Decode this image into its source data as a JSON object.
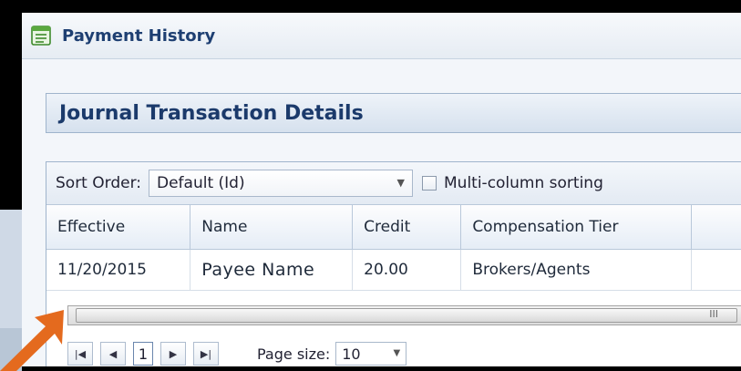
{
  "window": {
    "title": "Payment History"
  },
  "section": {
    "title": "Journal Transaction Details"
  },
  "sort": {
    "label": "Sort Order:",
    "selected": "Default (Id)",
    "multi_column_label": "Multi-column sorting"
  },
  "table": {
    "columns": [
      "Effective",
      "Name",
      "Credit",
      "Compensation Tier"
    ],
    "rows": [
      {
        "effective": "11/20/2015",
        "name": "Payee Name",
        "credit": "20.00",
        "tier": "Brokers/Agents"
      }
    ]
  },
  "scrollbar": {
    "grip": "III"
  },
  "pager": {
    "current_page": "1",
    "page_size_label": "Page size:",
    "page_size_value": "10"
  },
  "colors": {
    "accent": "#1e3f72",
    "annotation_arrow": "#e46a1e"
  },
  "icons": [
    "window-list-icon",
    "dropdown-arrow-icon",
    "first-page-icon",
    "prev-page-icon",
    "next-page-icon",
    "last-page-icon",
    "annotation-arrow-icon"
  ]
}
